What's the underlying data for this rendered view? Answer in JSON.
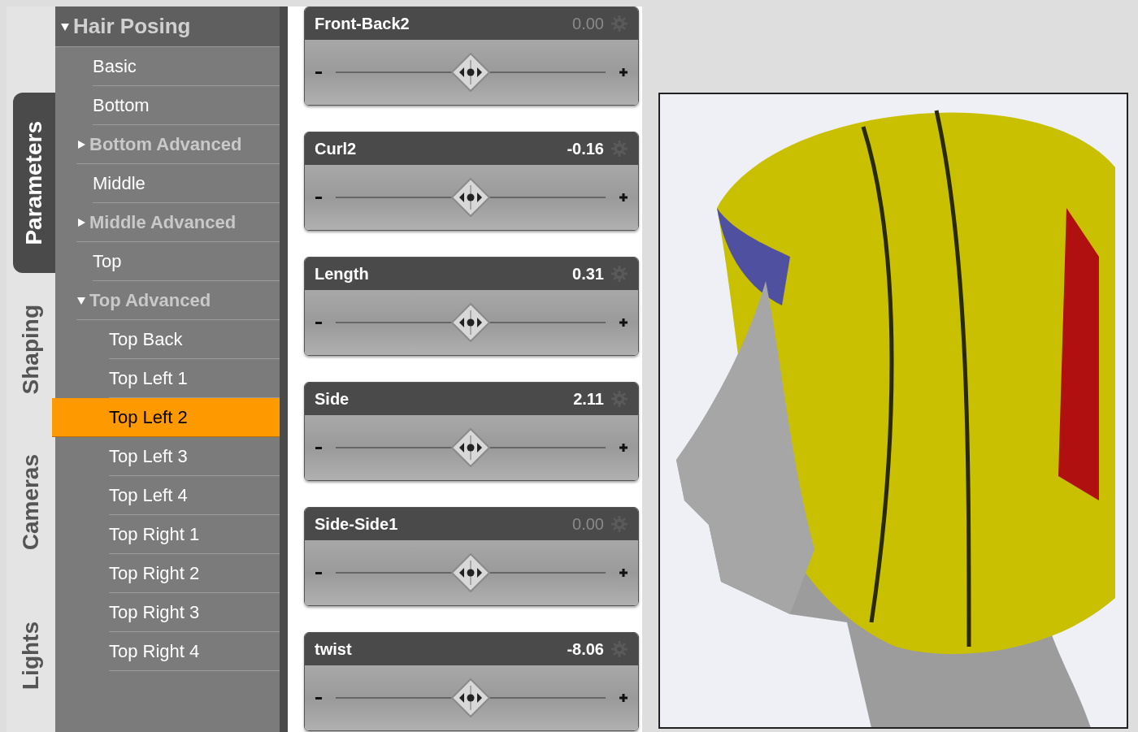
{
  "side_tabs": [
    {
      "label": "Parameters",
      "selected": true
    },
    {
      "label": "Shaping",
      "selected": false
    },
    {
      "label": "Cameras",
      "selected": false
    },
    {
      "label": "Lights",
      "selected": false
    }
  ],
  "tree": {
    "label": "Hair Posing",
    "expanded": true,
    "children": [
      {
        "label": "Basic",
        "kind": "leaf",
        "selected": false
      },
      {
        "label": "Bottom",
        "kind": "leaf",
        "selected": false
      },
      {
        "label": "Bottom Advanced",
        "kind": "group",
        "expanded": false
      },
      {
        "label": "Middle",
        "kind": "leaf",
        "selected": false
      },
      {
        "label": "Middle Advanced",
        "kind": "group",
        "expanded": false
      },
      {
        "label": "Top",
        "kind": "leaf",
        "selected": false
      },
      {
        "label": "Top Advanced",
        "kind": "group",
        "expanded": true,
        "children": [
          {
            "label": "Top Back",
            "kind": "leaf",
            "selected": false
          },
          {
            "label": "Top Left 1",
            "kind": "leaf",
            "selected": false
          },
          {
            "label": "Top Left 2",
            "kind": "leaf",
            "selected": true
          },
          {
            "label": "Top Left 3",
            "kind": "leaf",
            "selected": false
          },
          {
            "label": "Top Left 4",
            "kind": "leaf",
            "selected": false
          },
          {
            "label": "Top Right 1",
            "kind": "leaf",
            "selected": false
          },
          {
            "label": "Top Right 2",
            "kind": "leaf",
            "selected": false
          },
          {
            "label": "Top Right 3",
            "kind": "leaf",
            "selected": false
          },
          {
            "label": "Top Right 4",
            "kind": "leaf",
            "selected": false
          }
        ]
      }
    ]
  },
  "sliders": [
    {
      "name": "Front-Back2",
      "value": "0.00",
      "default": true,
      "level": 0.5
    },
    {
      "name": "Curl2",
      "value": "-0.16",
      "default": false,
      "level": 0.5
    },
    {
      "name": "Length",
      "value": "0.31",
      "default": false,
      "level": 0.5
    },
    {
      "name": "Side",
      "value": "2.11",
      "default": false,
      "level": 0.5
    },
    {
      "name": "Side-Side1",
      "value": "0.00",
      "default": true,
      "level": 0.5
    },
    {
      "name": "twist",
      "value": "-8.06",
      "default": false,
      "level": 0.5
    }
  ]
}
